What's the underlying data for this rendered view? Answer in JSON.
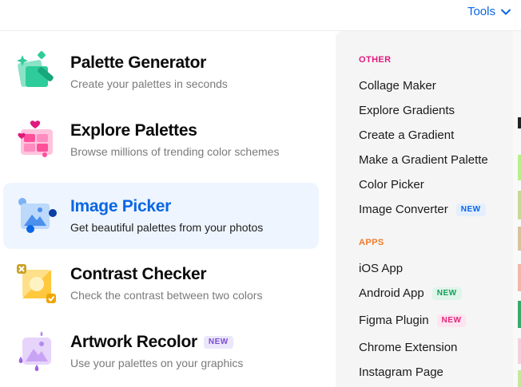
{
  "header": {
    "tools_label": "Tools"
  },
  "tools": [
    {
      "title": "Palette Generator",
      "subtitle": "Create your palettes in seconds",
      "icon": "palette-generator-icon"
    },
    {
      "title": "Explore Palettes",
      "subtitle": "Browse millions of trending color schemes",
      "icon": "explore-palettes-icon"
    },
    {
      "title": "Image Picker",
      "subtitle": "Get beautiful palettes from your photos",
      "icon": "image-picker-icon",
      "active": true
    },
    {
      "title": "Contrast Checker",
      "subtitle": "Check the contrast between two colors",
      "icon": "contrast-checker-icon"
    },
    {
      "title": "Artwork Recolor",
      "subtitle": "Use your palettes on your graphics",
      "icon": "artwork-recolor-icon",
      "badge": "NEW"
    }
  ],
  "other": {
    "label": "OTHER",
    "items": [
      {
        "label": "Collage Maker"
      },
      {
        "label": "Explore Gradients"
      },
      {
        "label": "Create a Gradient"
      },
      {
        "label": "Make a Gradient Palette"
      },
      {
        "label": "Color Picker"
      },
      {
        "label": "Image Converter",
        "badge": "NEW"
      }
    ]
  },
  "apps": {
    "label": "APPS",
    "items": [
      {
        "label": "iOS App"
      },
      {
        "label": "Android App",
        "badge": "NEW"
      },
      {
        "label": "Figma Plugin",
        "badge": "NEW"
      },
      {
        "label": "Chrome Extension"
      },
      {
        "label": "Instagram Page"
      }
    ]
  },
  "colors": {
    "accent": "#0a66e4",
    "other_label": "#e0197d",
    "apps_label": "#f07a2a",
    "active_bg": "#eef5fe"
  }
}
